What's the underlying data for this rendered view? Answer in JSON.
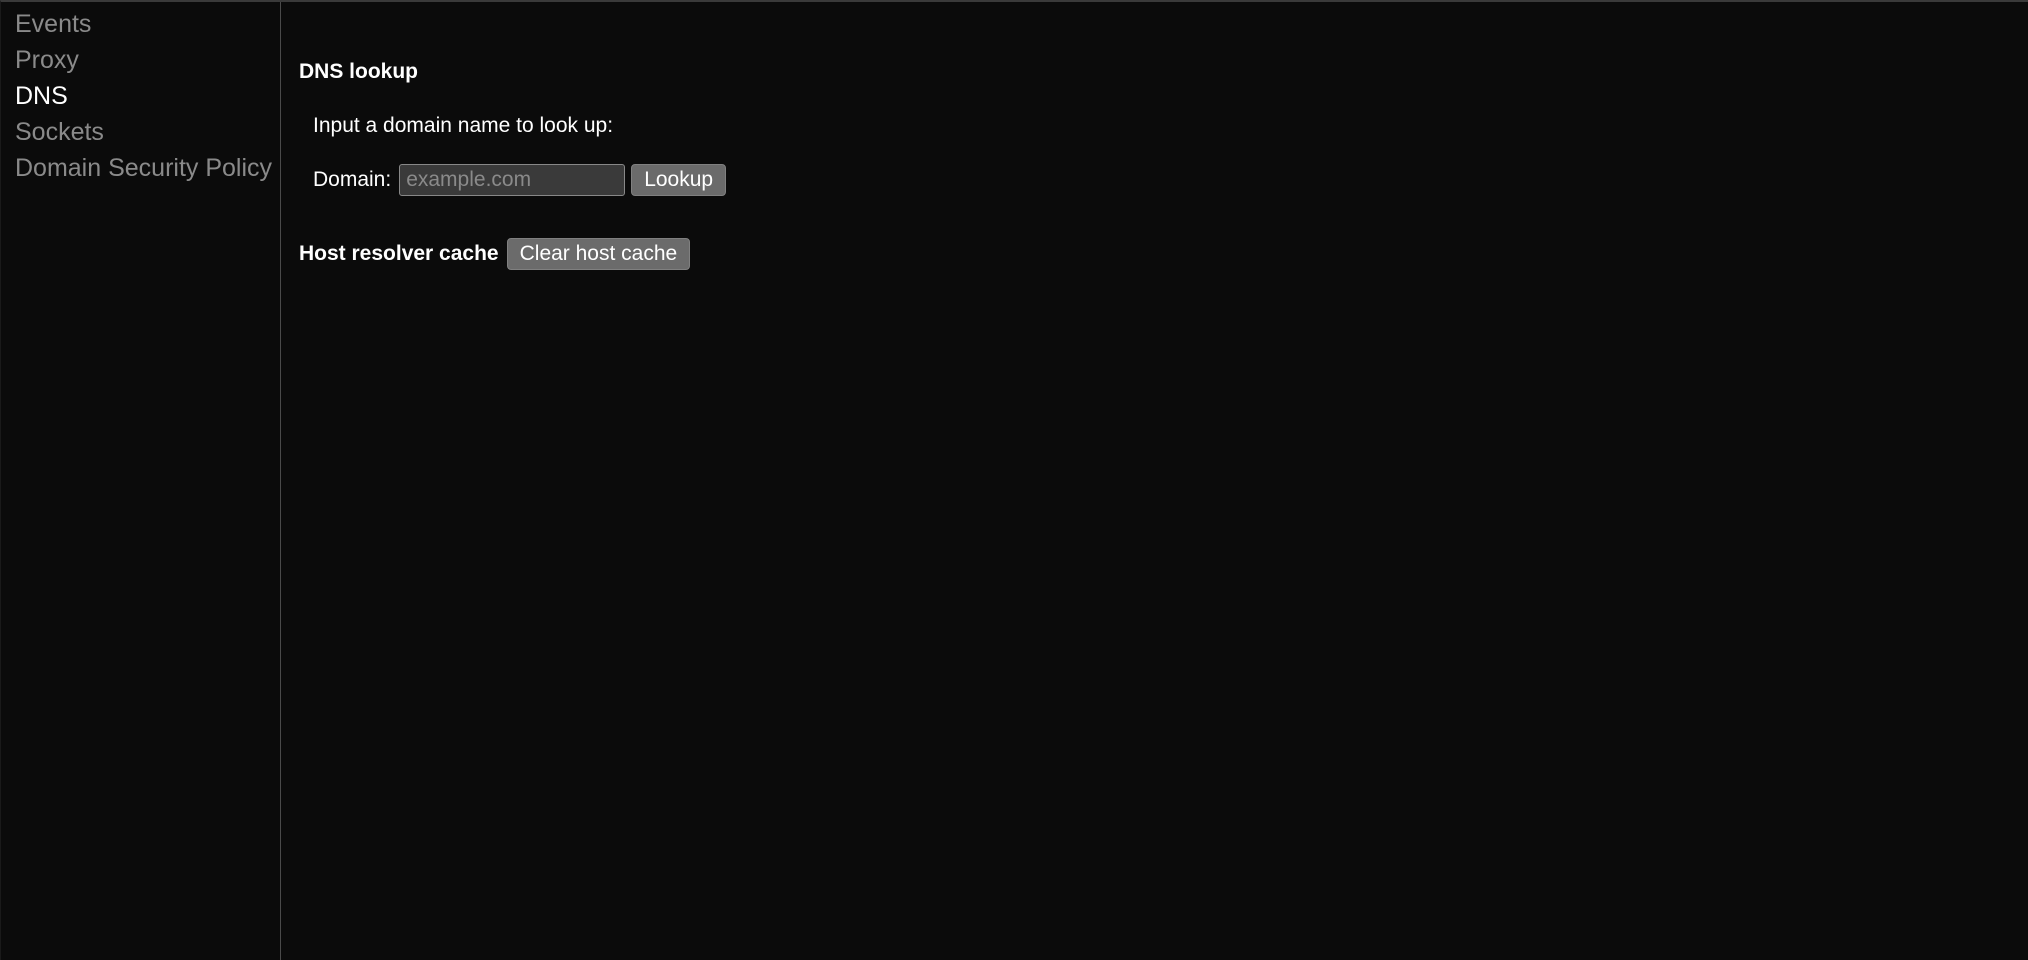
{
  "sidebar": {
    "items": [
      {
        "label": "Events",
        "name": "sidebar-item-events",
        "active": false
      },
      {
        "label": "Proxy",
        "name": "sidebar-item-proxy",
        "active": false
      },
      {
        "label": "DNS",
        "name": "sidebar-item-dns",
        "active": true
      },
      {
        "label": "Sockets",
        "name": "sidebar-item-sockets",
        "active": false
      },
      {
        "label": "Domain Security Policy",
        "name": "sidebar-item-domain-security-policy",
        "active": false
      }
    ]
  },
  "main": {
    "dns_lookup": {
      "title": "DNS lookup",
      "prompt": "Input a domain name to look up:",
      "domain_label": "Domain:",
      "domain_value": "",
      "domain_placeholder": "example.com",
      "lookup_button": "Lookup"
    },
    "host_resolver": {
      "label": "Host resolver cache",
      "clear_button": "Clear host cache"
    }
  }
}
